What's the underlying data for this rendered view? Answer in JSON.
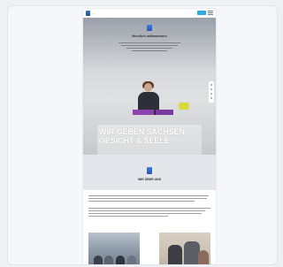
{
  "site": {
    "logo_text": "…",
    "nav_button_label": "…"
  },
  "hero": {
    "title": "Herzlich willkommen",
    "banner_line1": "WIR GEBEN SACHSEN",
    "banner_line2": "GESICHT & SEELE"
  },
  "about": {
    "title": "WIR ÜBER UNS"
  },
  "colors": {
    "accent_blue": "#27a9e1",
    "purple": "#8e44ad",
    "yellow": "#d9d93b"
  }
}
